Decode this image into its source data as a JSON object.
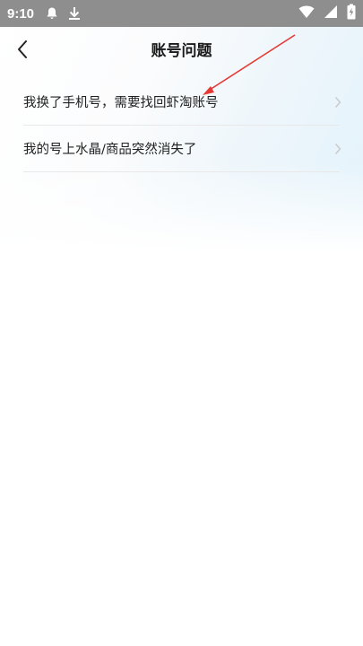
{
  "status_bar": {
    "time": "9:10",
    "icons": [
      "notification-bell-icon",
      "download-icon",
      "wifi-icon",
      "signal-icon",
      "battery-icon"
    ]
  },
  "header": {
    "title": "账号问题",
    "back_icon": "chevron-left-icon"
  },
  "list": {
    "items": [
      {
        "label": "我换了手机号，需要找回虾淘账号",
        "icon": "chevron-right-icon"
      },
      {
        "label": "我的号上水晶/商品突然消失了",
        "icon": "chevron-right-icon"
      }
    ]
  },
  "colors": {
    "status_bar_bg": "#8e8e8e",
    "annotation_arrow": "#e53935",
    "divider": "#e8e8e8",
    "chevron": "#c8c8c8"
  }
}
